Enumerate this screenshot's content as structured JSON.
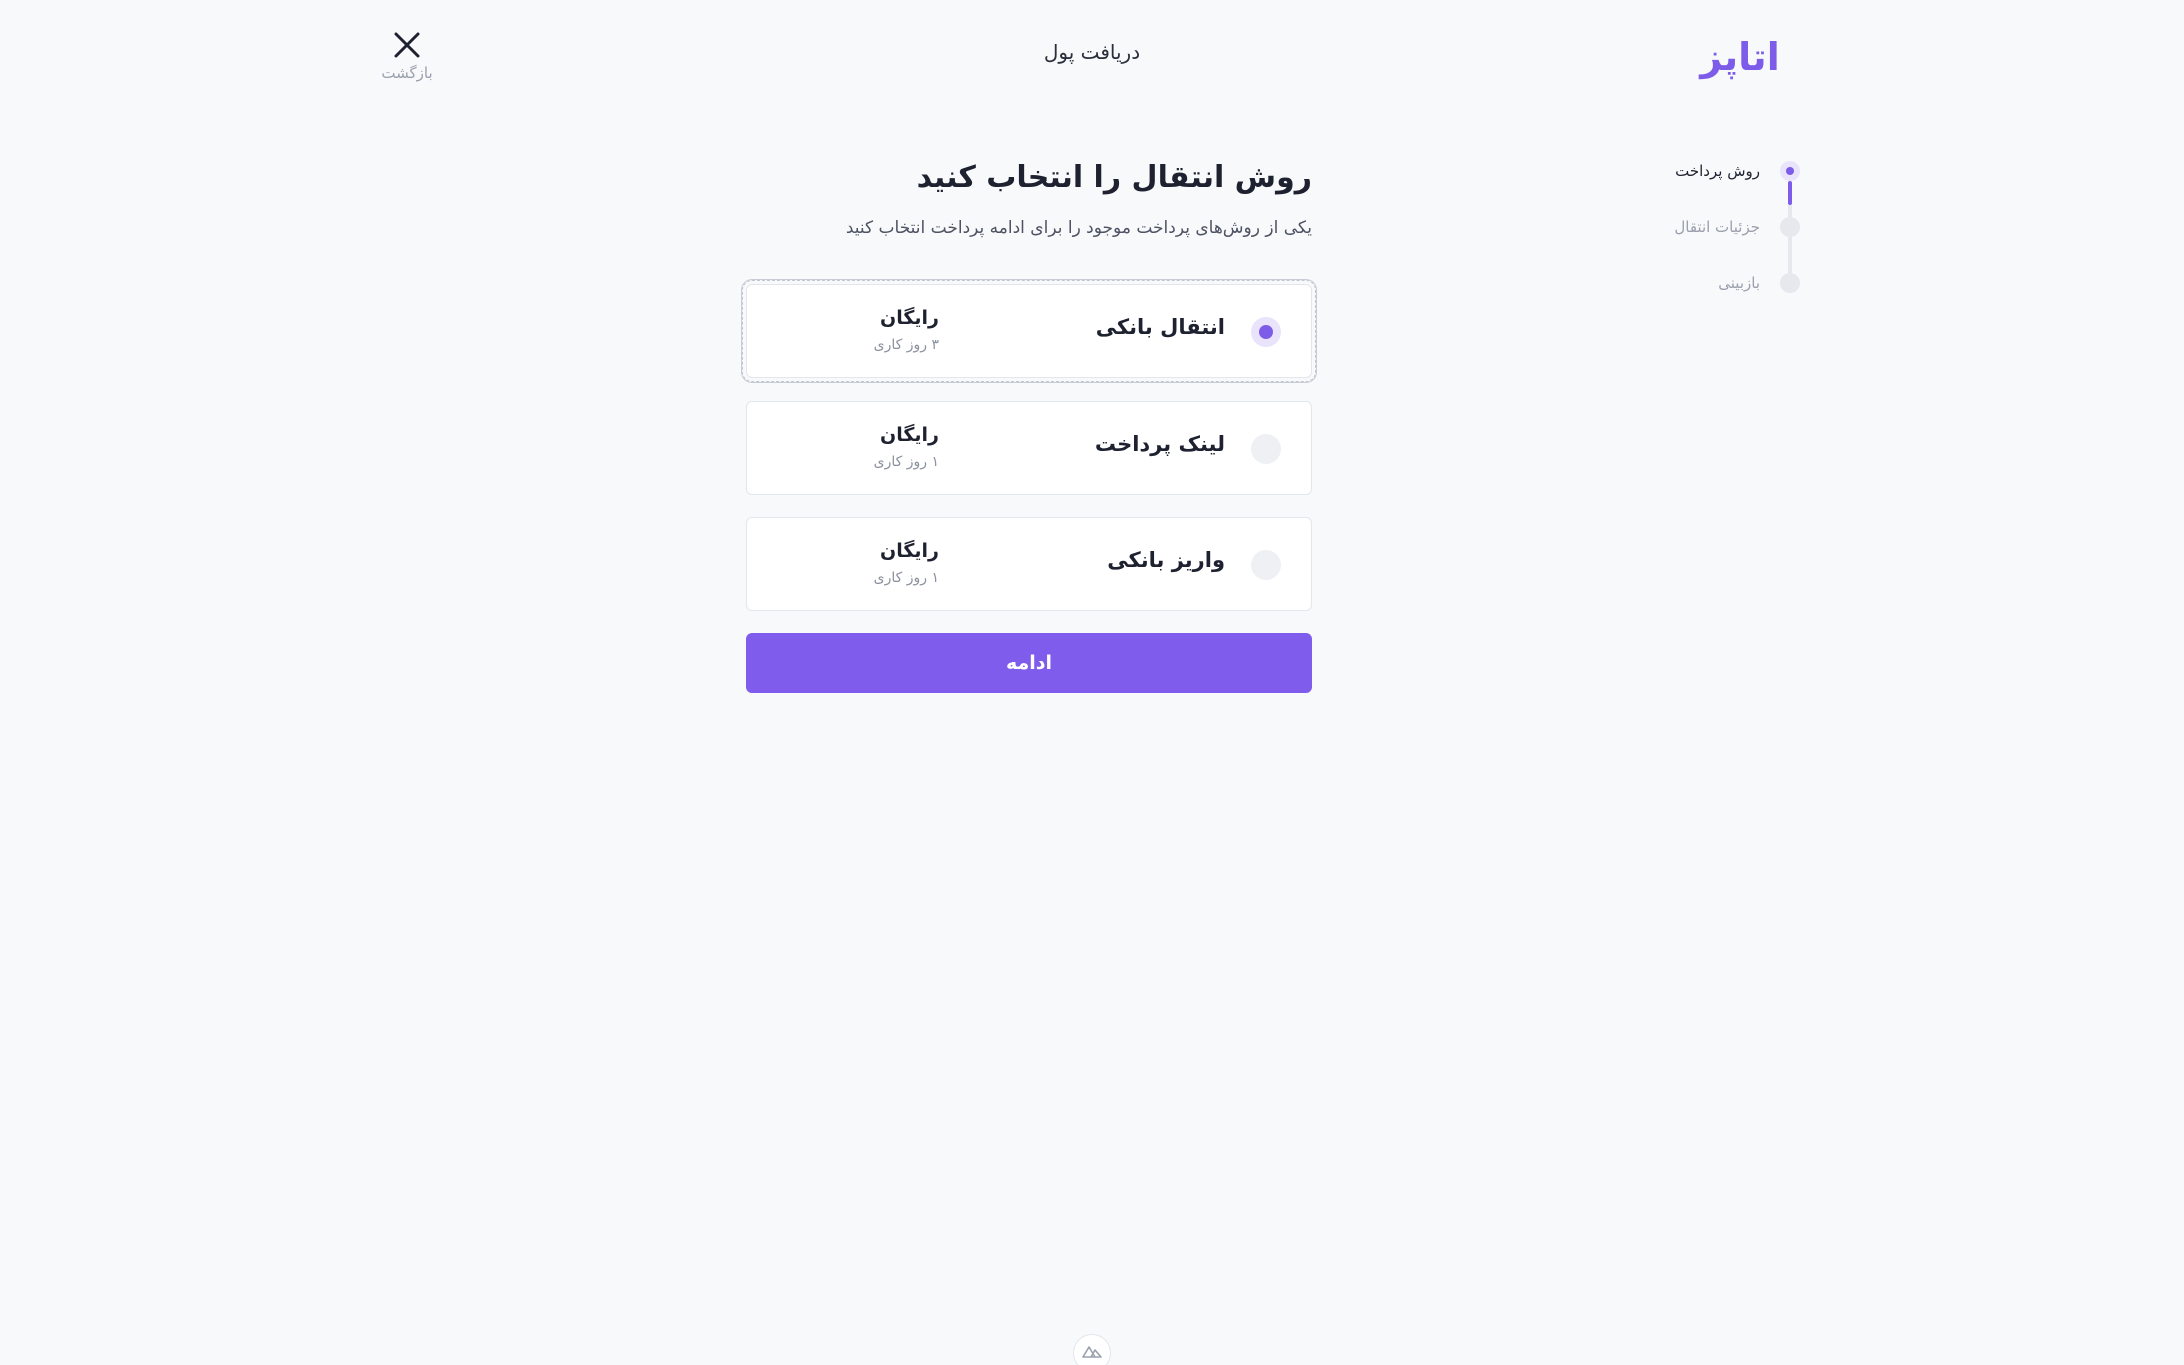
{
  "header": {
    "logo_text": "اتاپز",
    "title": "دریافت پول",
    "close_label": "بازگشت"
  },
  "stepper": {
    "steps": [
      {
        "label": "روش پرداخت",
        "state": "active"
      },
      {
        "label": "جزئیات انتقال",
        "state": "pending"
      },
      {
        "label": "بازبینی",
        "state": "pending"
      }
    ]
  },
  "main": {
    "heading": "روش انتقال را انتخاب کنید",
    "subheading": "یکی از روش‌های پرداخت موجود را برای ادامه پرداخت انتخاب کنید",
    "options": [
      {
        "label": "انتقال بانکی",
        "fee": "رایگان",
        "time": "۳ روز کاری",
        "selected": true
      },
      {
        "label": "لینک پرداخت",
        "fee": "رایگان",
        "time": "۱ روز کاری",
        "selected": false
      },
      {
        "label": "واریز بانکی",
        "fee": "رایگان",
        "time": "۱ روز کاری",
        "selected": false
      }
    ],
    "continue_label": "ادامه"
  },
  "colors": {
    "accent": "#7f5cec",
    "background": "#f8f9fb",
    "text": "#1e2230",
    "muted": "#9aa0ad"
  },
  "icons": {
    "close": "close-icon",
    "bottom": "nuxt-logo-icon"
  }
}
